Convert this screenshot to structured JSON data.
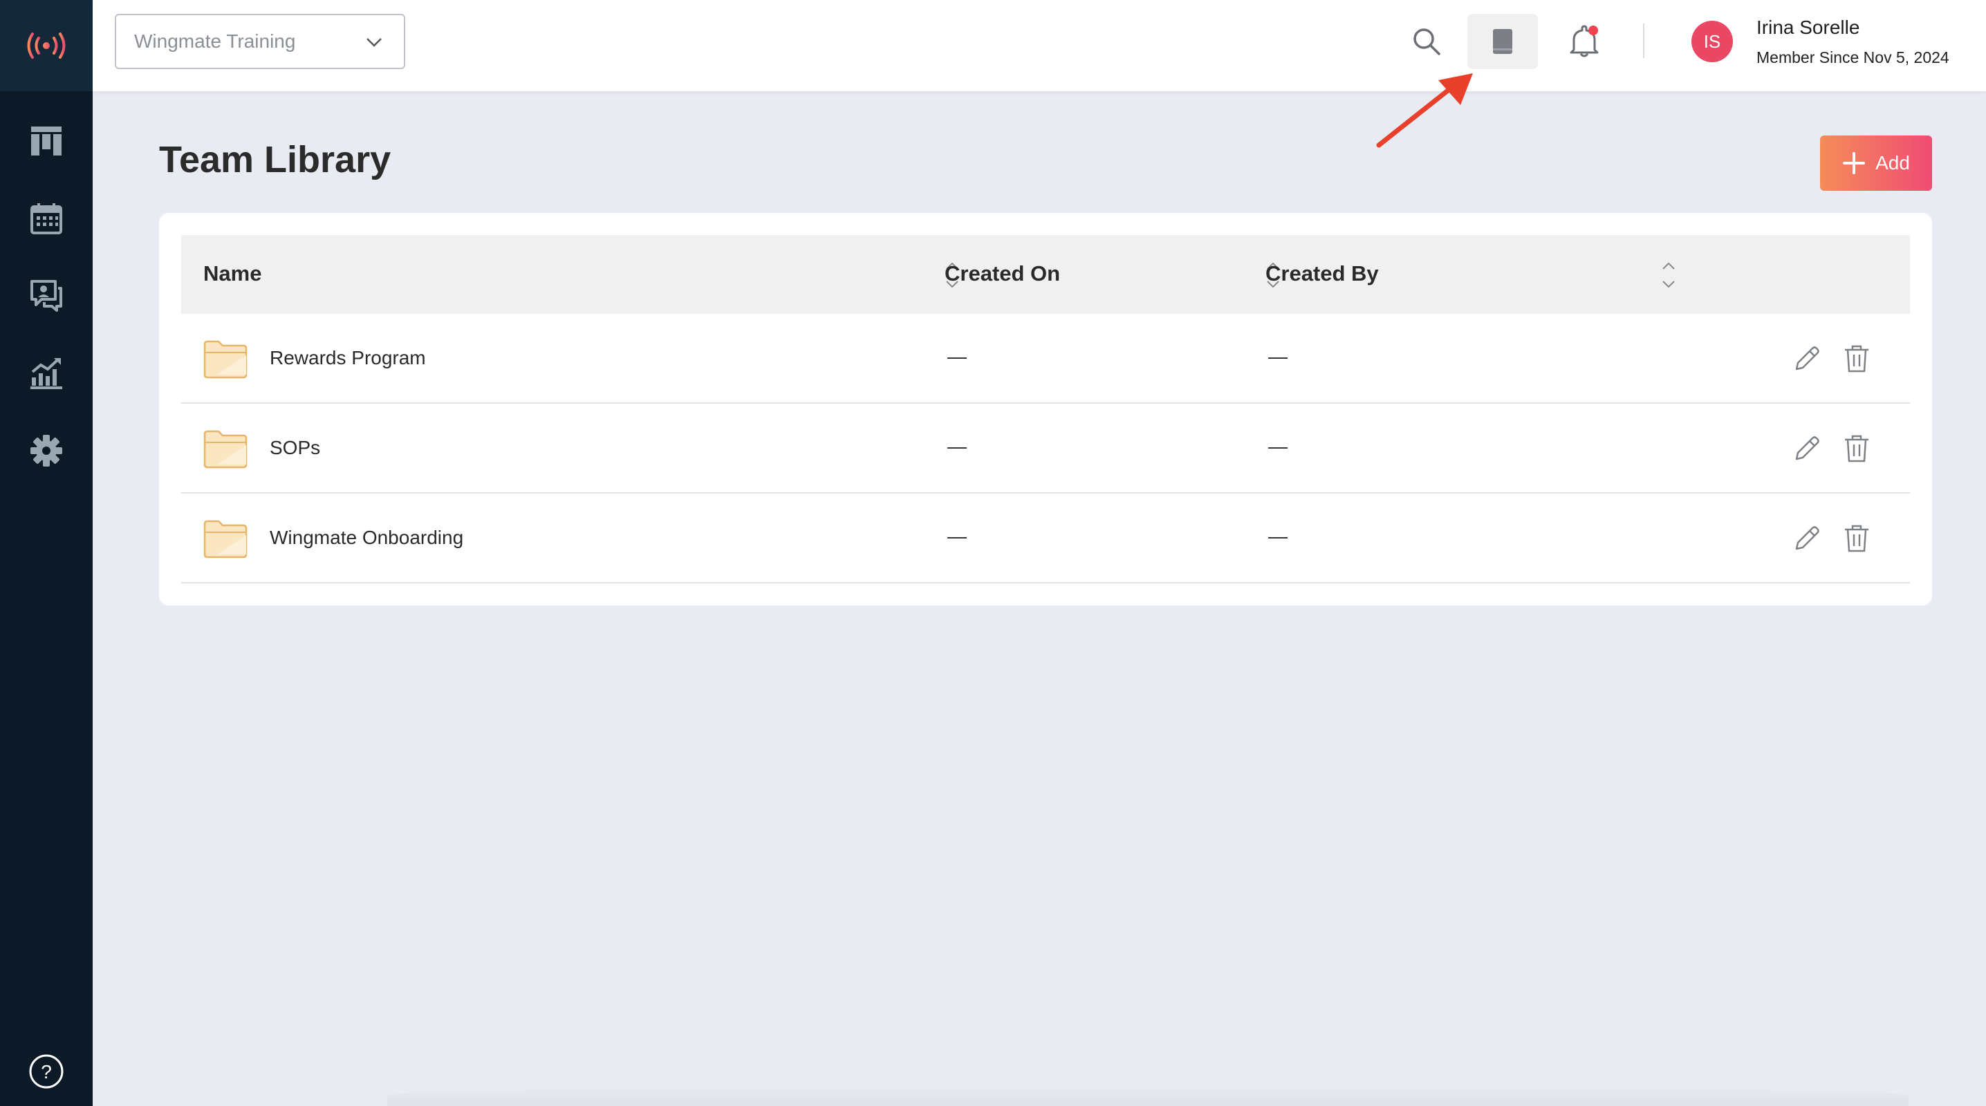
{
  "workspace": {
    "selected": "Wingmate Training"
  },
  "user": {
    "initials": "IS",
    "name": "Irina Sorelle",
    "member_since": "Member Since Nov 5, 2024"
  },
  "page": {
    "title": "Team Library",
    "add_label": "Add"
  },
  "table": {
    "columns": [
      "Name",
      "Created On",
      "Created By"
    ],
    "rows": [
      {
        "name": "Rewards Program",
        "created_on": "—",
        "created_by": "—"
      },
      {
        "name": "SOPs",
        "created_on": "—",
        "created_by": "—"
      },
      {
        "name": "Wingmate Onboarding",
        "created_on": "—",
        "created_by": "—"
      }
    ]
  },
  "icons": {
    "sidebar": [
      "logo-icon",
      "board-icon",
      "calendar-icon",
      "chat-icon",
      "analytics-icon",
      "gear-icon",
      "help-icon"
    ],
    "topbar": [
      "search-icon",
      "book-icon",
      "bell-icon"
    ]
  },
  "colors": {
    "accent_start": "#f58c58",
    "accent_end": "#ef4c74",
    "sidebar": "#0b1a26",
    "avatar": "#ea4764",
    "notification_dot": "#ee4350",
    "annotation_arrow": "#e8402b"
  }
}
